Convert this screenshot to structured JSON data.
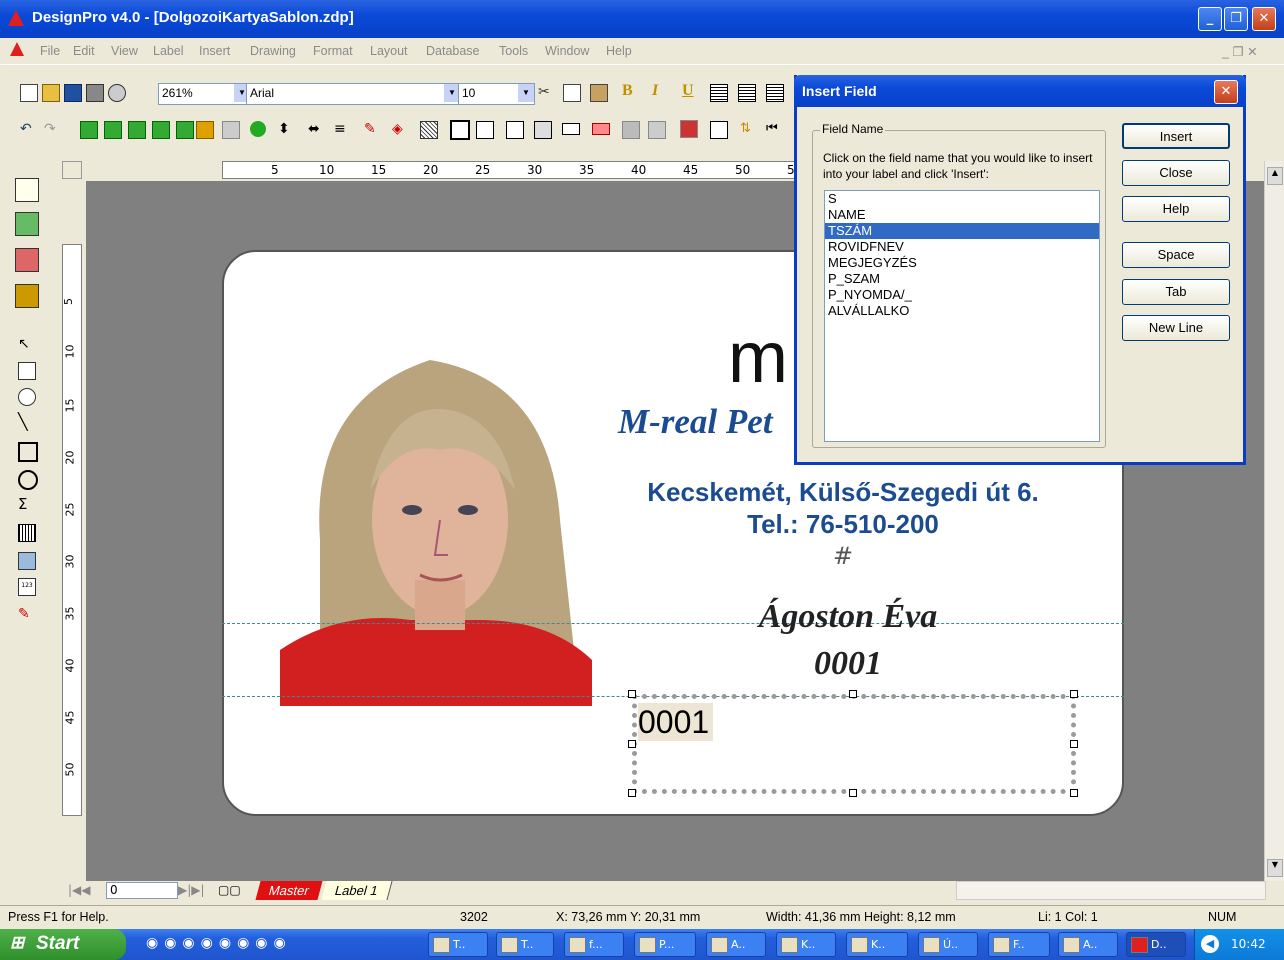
{
  "window": {
    "title": "DesignPro v4.0 - [DolgozoiKartyaSablon.zdp]",
    "minimize": "_",
    "restore": "❐",
    "close": "✕"
  },
  "menu": [
    "File",
    "Edit",
    "View",
    "Label",
    "Insert",
    "Drawing",
    "Format",
    "Layout",
    "Database",
    "Tools",
    "Window",
    "Help"
  ],
  "toolbar": {
    "zoom": "261%",
    "font": "Arial",
    "size": "10",
    "bold": "B",
    "italic": "I",
    "underline": "U"
  },
  "ruler": {
    "h_ticks": [
      "5",
      "10",
      "15",
      "20",
      "25",
      "30",
      "35",
      "40",
      "45",
      "50",
      "5"
    ],
    "v_ticks": [
      "5",
      "10",
      "15",
      "20",
      "25",
      "30",
      "35",
      "40",
      "45",
      "50"
    ]
  },
  "card": {
    "logo": "m",
    "company": "M-real Pet",
    "address": "Kecskemét, Külső-Szegedi út 6.",
    "phone": "Tel.: 76-510-200",
    "hash": "#",
    "name": "Ágoston Éva",
    "number": "0001",
    "field_value": "0001"
  },
  "page_nav": {
    "page": "0",
    "tab_master": "Master",
    "tab_label": "Label 1"
  },
  "status": {
    "help": "Press F1 for Help.",
    "count": "3202",
    "pos": "X: 73,26 mm  Y: 20,31 mm",
    "size": "Width: 41,36 mm  Height: 8,12 mm",
    "line": "Li: 1  Col: 1",
    "num": "NUM"
  },
  "dialog": {
    "title": "Insert Field",
    "group": "Field Name",
    "instructions": "Click on the field name that you would like to insert into your label and click 'Insert':",
    "fields": [
      "S",
      "NAME",
      "TSZÁM",
      "ROVIDFNEV",
      "MEGJEGYZÉS",
      "P_SZAM",
      "P_NYOMDA/_",
      "ALVÁLLALKO"
    ],
    "selected_index": 2,
    "buttons": {
      "insert": "Insert",
      "close": "Close",
      "help": "Help",
      "space": "Space",
      "tab": "Tab",
      "newline": "New Line"
    }
  },
  "taskbar": {
    "start": "Start",
    "tasks": [
      "T..",
      "T..",
      "f...",
      "P...",
      "A..",
      "K..",
      "K..",
      "Ú..",
      "F..",
      "A..",
      "D.."
    ],
    "clock": "10:42"
  },
  "colors": {
    "accent": "#0a4ad8",
    "card_text_blue": "#1b4b91",
    "master_tab": "#e01010",
    "selection": "#316ac5"
  }
}
